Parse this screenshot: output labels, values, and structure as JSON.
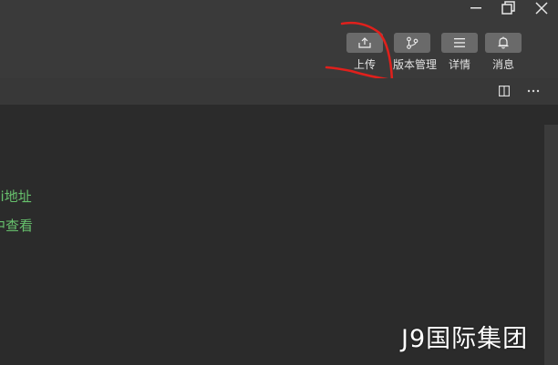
{
  "window_controls": {
    "minimize_icon": "minimize-icon",
    "restore_icon": "restore-icon",
    "close_icon": "close-icon"
  },
  "toolbar": {
    "upload_label": "上传",
    "version_label": "版本管理",
    "details_label": "详情",
    "messages_label": "消息"
  },
  "tabbar": {
    "split_icon": "split-editor-icon",
    "more_icon": "more-icon"
  },
  "editor": {
    "lines": [
      "pi地址",
      "中查看"
    ]
  },
  "watermark": "J9国际集团",
  "colors": {
    "titlebar": "#3a3a3a",
    "tabbar": "#383838",
    "editor_bg": "#2b2b2b",
    "button_bg": "#6a6a6a",
    "code_green": "#67c16d",
    "annotation_red": "#e0201c"
  }
}
